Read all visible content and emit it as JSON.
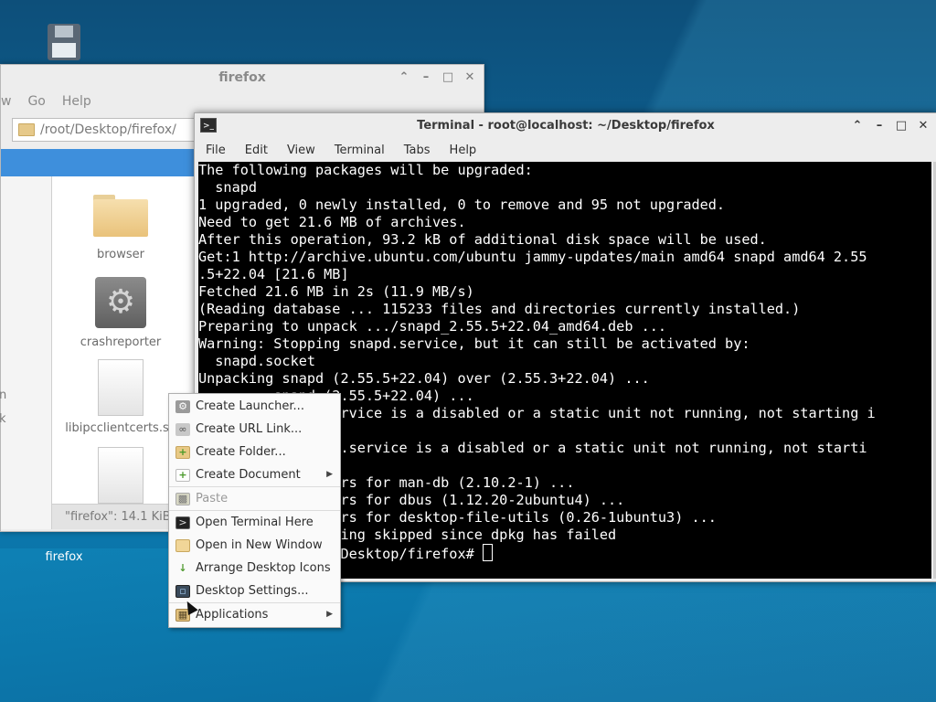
{
  "desktop": {
    "icons": [
      {
        "label": ""
      },
      {
        "label": "firefox"
      }
    ]
  },
  "file_manager": {
    "title": "firefox",
    "menu": [
      "w",
      "Go",
      "Help"
    ],
    "location": "/root/Desktop/firefox/",
    "side_letters": [
      "n",
      "k"
    ],
    "items": [
      {
        "label": "browser",
        "icon": "folder-icon"
      },
      {
        "label": "crashreporter",
        "icon": "gear-icon"
      },
      {
        "label": "libipcclientcerts.so",
        "icon": "document-icon"
      },
      {
        "label": "",
        "icon": "document-icon"
      }
    ],
    "status": "\"firefox\": 14.1 KiB"
  },
  "terminal": {
    "title": "Terminal - root@localhost: ~/Desktop/firefox",
    "menu": [
      "File",
      "Edit",
      "View",
      "Terminal",
      "Tabs",
      "Help"
    ],
    "lines": [
      "The following packages will be upgraded:",
      "  snapd",
      "1 upgraded, 0 newly installed, 0 to remove and 95 not upgraded.",
      "Need to get 21.6 MB of archives.",
      "After this operation, 93.2 kB of additional disk space will be used.",
      "Get:1 http://archive.ubuntu.com/ubuntu jammy-updates/main amd64 snapd amd64 2.55",
      ".5+22.04 [21.6 MB]",
      "Fetched 21.6 MB in 2s (11.9 MB/s)",
      "(Reading database ... 115233 files and directories currently installed.)",
      "Preparing to unpack .../snapd_2.55.5+22.04_amd64.deb ...",
      "Warning: Stopping snapd.service, but it can still be activated by:",
      "  snapd.socket",
      "Unpacking snapd (2.55.5+22.04) over (2.55.3+22.04) ...",
      "         snapd (2.55.5+22.04) ...",
      "               service is a disabled or a static unit not running, not starting i",
      "",
      "               ir.service is a disabled or a static unit not running, not starti",
      "",
      "               gers for man-db (2.10.2-1) ...",
      "               gers for dbus (1.12.20-2ubuntu4) ...",
      "               gers for desktop-file-utils (0.26-1ubuntu3) ...",
      "               being skipped since dpkg has failed",
      "               ~/Desktop/firefox# "
    ]
  },
  "context_menu": {
    "items": [
      {
        "label": "Create Launcher...",
        "icon": "launcher-icon",
        "disabled": false,
        "submenu": false
      },
      {
        "label": "Create URL Link...",
        "icon": "link-icon",
        "disabled": false,
        "submenu": false
      },
      {
        "label": "Create Folder...",
        "icon": "new-folder-icon",
        "disabled": false,
        "submenu": false
      },
      {
        "label": "Create Document",
        "icon": "new-document-icon",
        "disabled": false,
        "submenu": true
      },
      {
        "label": "Paste",
        "icon": "paste-icon",
        "disabled": true,
        "submenu": false
      },
      {
        "label": "Open Terminal Here",
        "icon": "terminal-icon",
        "disabled": false,
        "submenu": false
      },
      {
        "label": "Open in New Window",
        "icon": "folder-open-icon",
        "disabled": false,
        "submenu": false
      },
      {
        "label": "Arrange Desktop Icons",
        "icon": "arrange-icon",
        "disabled": false,
        "submenu": false
      },
      {
        "label": "Desktop Settings...",
        "icon": "display-icon",
        "disabled": false,
        "submenu": false
      },
      {
        "label": "Applications",
        "icon": "applications-icon",
        "disabled": false,
        "submenu": true
      }
    ]
  }
}
